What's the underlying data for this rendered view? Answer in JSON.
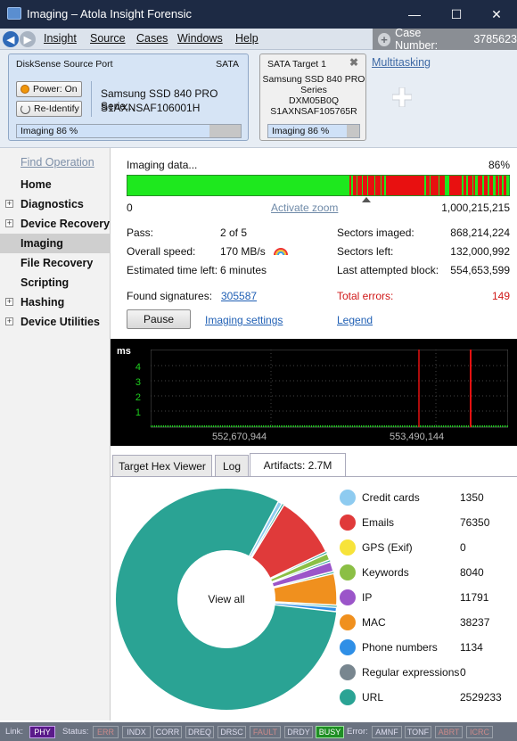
{
  "window": {
    "title": "Imaging – Atola Insight Forensic"
  },
  "menu": {
    "items": [
      "Insight",
      "Source",
      "Cases",
      "Windows",
      "Help"
    ],
    "case_label": "Case Number:",
    "case_number": "3785623"
  },
  "source_port": {
    "header": "DiskSense Source Port",
    "interface": "SATA",
    "power_btn": "Power: On",
    "reidentify_btn": "Re-Identify",
    "model": "Samsung SSD 840 PRO Serie...",
    "serial": "S1AXNSAF106001H",
    "progress_label": "Imaging  86 %",
    "progress": 0.86
  },
  "target_port": {
    "header": "SATA Target 1",
    "model_line1": "Samsung SSD 840 PRO",
    "model_line2": "Series",
    "firmware": "DXM05B0Q",
    "serial": "S1AXNSAF105765R",
    "progress_label": "Imaging  86 %",
    "progress": 0.86
  },
  "multitasking": "Multitasking",
  "sidebar": {
    "find": "Find Operation",
    "items": [
      {
        "label": "Home",
        "expand": false
      },
      {
        "label": "Diagnostics",
        "expand": true
      },
      {
        "label": "Device Recovery",
        "expand": true
      },
      {
        "label": "Imaging",
        "expand": false,
        "active": true
      },
      {
        "label": "File Recovery",
        "expand": false
      },
      {
        "label": "Scripting",
        "expand": false
      },
      {
        "label": "Hashing",
        "expand": true
      },
      {
        "label": "Device Utilities",
        "expand": true
      }
    ]
  },
  "imaging": {
    "title": "Imaging data...",
    "percent": "86%",
    "range_start": "0",
    "activate_zoom": "Activate zoom",
    "range_end": "1,000,215,215",
    "pass_label": "Pass:",
    "pass_value": "2 of 5",
    "speed_label": "Overall speed:",
    "speed_value": "170 MB/s",
    "time_label": "Estimated time left:",
    "time_value": "6 minutes",
    "sectors_imaged_label": "Sectors imaged:",
    "sectors_imaged_value": "868,214,224",
    "sectors_left_label": "Sectors left:",
    "sectors_left_value": "132,000,992",
    "last_block_label": "Last attempted block:",
    "last_block_value": "554,653,599",
    "signatures_label": "Found signatures:",
    "signatures_value": "305587",
    "errors_label": "Total errors:",
    "errors_value": "149",
    "pause_btn": "Pause",
    "settings_link": "Imaging settings",
    "legend_link": "Legend"
  },
  "graph": {
    "unit": "ms",
    "y_ticks": [
      "4",
      "3",
      "2",
      "1"
    ],
    "x_label_1": "552,670,944",
    "x_label_2": "553,490,144"
  },
  "tabs": [
    "Target Hex Viewer",
    "Log",
    "Artifacts: 2.7M"
  ],
  "artifacts": {
    "center_label": "View all",
    "items": [
      {
        "name": "Credit cards",
        "value": 1350,
        "color": "#8ecbf0"
      },
      {
        "name": "Emails",
        "value": 76350,
        "color": "#e03a3a"
      },
      {
        "name": "GPS (Exif)",
        "value": 0,
        "color": "#f7e33a"
      },
      {
        "name": "Keywords",
        "value": 8040,
        "color": "#8bbf45"
      },
      {
        "name": "IP",
        "value": 11791,
        "color": "#9b55c9"
      },
      {
        "name": "MAC",
        "value": 38237,
        "color": "#f0901e"
      },
      {
        "name": "Phone numbers",
        "value": 1134,
        "color": "#2f8fe6"
      },
      {
        "name": "Regular expressions",
        "value": 0,
        "color": "#78868f"
      },
      {
        "name": "URL",
        "value": 2529233,
        "color": "#2aa394"
      }
    ]
  },
  "statusbar": {
    "link_label": "Link:",
    "link_tag": "PHY",
    "status_label": "Status:",
    "status_tags": [
      "ERR",
      "INDX",
      "CORR",
      "DREQ",
      "DRSC",
      "FAULT",
      "DRDY",
      "BUSY"
    ],
    "error_label": "Error:",
    "error_tags": [
      "AMNF",
      "TONF",
      "ABRT",
      "ICRC"
    ]
  }
}
